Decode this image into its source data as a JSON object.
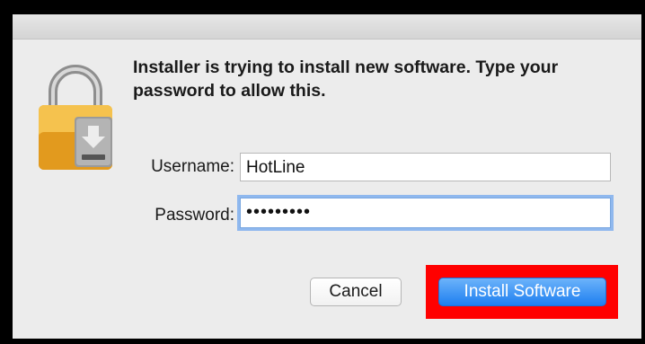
{
  "dialog": {
    "message": "Installer is trying to install new software. Type your password to allow this."
  },
  "form": {
    "username_label": "Username:",
    "username_value": "HotLine",
    "password_label": "Password:",
    "password_value": "•••••••••"
  },
  "buttons": {
    "cancel": "Cancel",
    "install": "Install Software"
  },
  "icons": {
    "lock": "lock-icon",
    "download": "download-arrow-icon"
  },
  "colors": {
    "accent": "#1e7ff0",
    "highlight": "#ff0000",
    "focus_ring": "#8fb8ee"
  }
}
